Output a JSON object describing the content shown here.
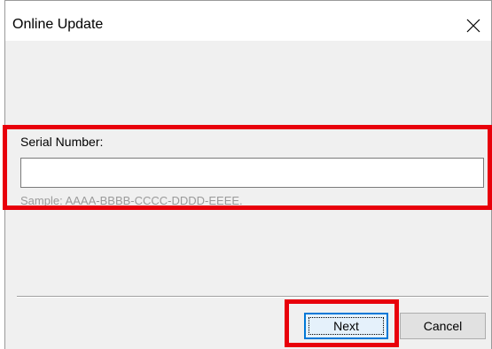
{
  "window": {
    "title": "Online Update",
    "close_icon": "close-icon"
  },
  "form": {
    "serial_label": "Serial Number:",
    "serial_value": "",
    "serial_placeholder": "",
    "sample_hint": "Sample: AAAA-BBBB-CCCC-DDDD-EEEE."
  },
  "buttons": {
    "next_label": "Next",
    "cancel_label": "Cancel"
  },
  "colors": {
    "highlight": "#e8000b",
    "focus_border": "#0078d7"
  }
}
